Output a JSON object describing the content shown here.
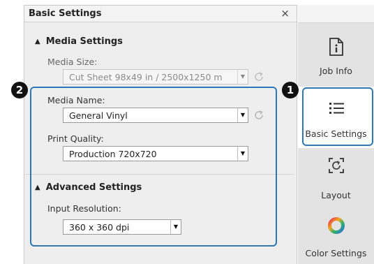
{
  "panel": {
    "title": "Basic Settings",
    "close_glyph": "×"
  },
  "media_settings": {
    "title": "Media Settings",
    "media_size_label": "Media Size:",
    "media_size_value": "Cut Sheet 98x49 in / 2500x1250 m",
    "media_name_label": "Media Name:",
    "media_name_value": "General Vinyl",
    "print_quality_label": "Print Quality:",
    "print_quality_value": "Production 720x720"
  },
  "advanced_settings": {
    "title": "Advanced Settings",
    "input_resolution_label": "Input Resolution:",
    "input_resolution_value": "360 x 360 dpi"
  },
  "nav": {
    "items": [
      {
        "label": "Job Info",
        "icon": "document-info-icon"
      },
      {
        "label": "Basic Settings",
        "icon": "list-icon"
      },
      {
        "label": "Layout",
        "icon": "layout-refresh-icon"
      },
      {
        "label": "Color Settings",
        "icon": "color-wheel-icon"
      }
    ]
  },
  "callouts": {
    "badge_1": "1",
    "badge_2": "2"
  },
  "colors": {
    "callout_border": "#2d79b8",
    "panel_bg": "#eeeeee",
    "nav_bg": "#e3e3e3",
    "nav_selected_bg": "#ffffff"
  }
}
